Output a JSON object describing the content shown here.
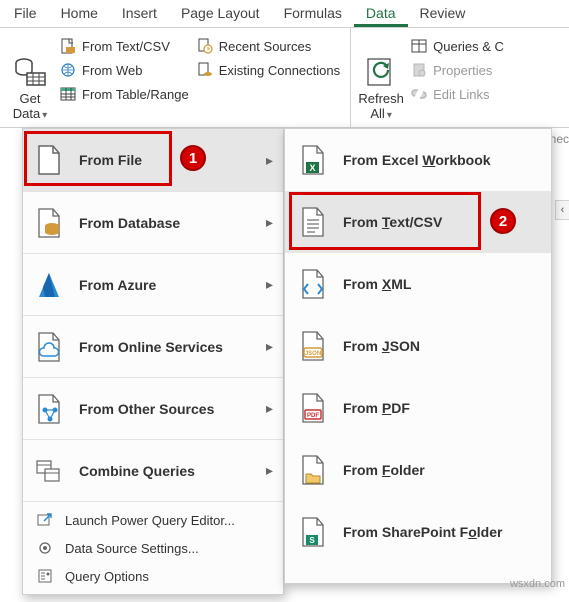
{
  "tabs": {
    "file": "File",
    "home": "Home",
    "insert": "Insert",
    "page_layout": "Page Layout",
    "formulas": "Formulas",
    "data": "Data",
    "review": "Review"
  },
  "ribbon": {
    "get_data": {
      "line1": "Get",
      "line2": "Data"
    },
    "from_text_csv": "From Text/CSV",
    "from_web": "From Web",
    "from_table": "From Table/Range",
    "recent_sources": "Recent Sources",
    "existing_connections": "Existing Connections",
    "refresh_all": {
      "line1": "Refresh",
      "line2": "All"
    },
    "queries": "Queries & C",
    "properties": "Properties",
    "edit_links": "Edit Links"
  },
  "menu": {
    "from_file": "From File",
    "from_database": "From Database",
    "from_azure": "From Azure",
    "from_online": "From Online Services",
    "from_other": "From Other Sources",
    "combine": "Combine Queries",
    "launch_pq": "Launch Power Query Editor...",
    "ds_settings": "Data Source Settings...",
    "query_options": "Query Options"
  },
  "submenu": {
    "excel_pre": "From Excel ",
    "excel_u": "W",
    "excel_post": "orkbook",
    "text_pre": "From ",
    "text_u": "T",
    "text_post": "ext/CSV",
    "xml_pre": "From ",
    "xml_u": "X",
    "xml_post": "ML",
    "json_pre": "From ",
    "json_u": "J",
    "json_post": "SON",
    "pdf_pre": "From ",
    "pdf_u": "P",
    "pdf_post": "DF",
    "folder_pre": "From ",
    "folder_u": "F",
    "folder_post": "older",
    "sp_pre": "From SharePoint F",
    "sp_u": "o",
    "sp_post": "lder"
  },
  "annotations": {
    "badge1": "1",
    "badge2": "2"
  },
  "misc": {
    "onnec": "onnec",
    "watermark": "wsxdn.com"
  }
}
